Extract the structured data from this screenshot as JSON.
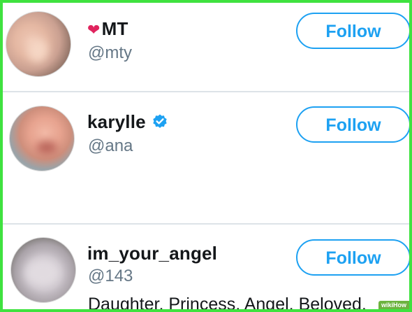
{
  "users": [
    {
      "name": "MT",
      "handle": "@mty",
      "follow_label": "Follow",
      "name_prefix_icon": "heart-icon"
    },
    {
      "name": "karylle",
      "handle": "@ana",
      "follow_label": "Follow",
      "verified": true
    },
    {
      "name": "im_your_angel",
      "handle": "@143",
      "follow_label": "Follow",
      "bio": "Daughter, Princess, Angel, Beloved,"
    }
  ],
  "watermark": {
    "text": "wikiHow"
  },
  "colors": {
    "accent": "#1da1f2",
    "frame_border": "#3fe23f",
    "heart": "#e0245e",
    "handle": "#657786"
  }
}
